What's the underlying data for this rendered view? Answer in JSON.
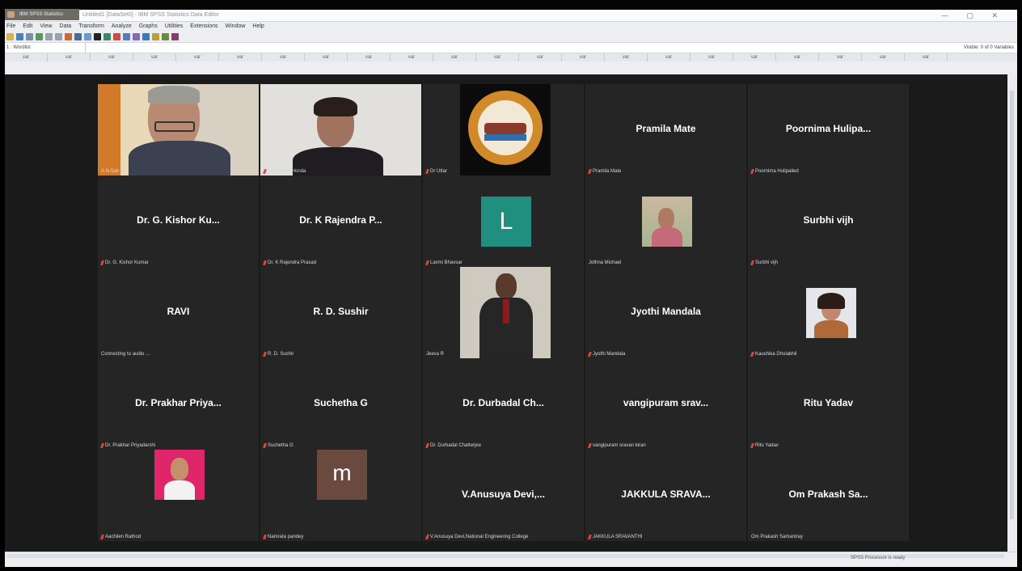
{
  "window": {
    "title": "Untitled1 [DataSet0] - IBM SPSS Statistics Data Editor",
    "logo_label": "IBM SPSS Statistics"
  },
  "menu": [
    "File",
    "Edit",
    "View",
    "Data",
    "Transform",
    "Analyze",
    "Graphs",
    "Utilities",
    "Extensions",
    "Window",
    "Help"
  ],
  "spss": {
    "var_cell": "1 : Wordlist",
    "visible": "Visible: 0 of 0 Variables",
    "status": "SPSS Processor is ready",
    "columns": [
      "var",
      "var",
      "var",
      "var",
      "var",
      "var",
      "var",
      "var",
      "var",
      "var",
      "var",
      "var",
      "var",
      "var",
      "var",
      "var",
      "var",
      "var",
      "var",
      "var",
      "var",
      "var"
    ]
  },
  "participants": [
    {
      "label": "A.N.Sah",
      "muted": false
    },
    {
      "label": "Dr.Sunitha Honda",
      "muted": true
    },
    {
      "label": "Dr Uttar",
      "muted": true
    },
    {
      "name": "Pramila Mate",
      "label": "Pramila Mate",
      "muted": true
    },
    {
      "name": "Poornima Hulipa...",
      "label": "Poornima Hulipalled",
      "muted": true
    },
    {
      "name": "Dr. G. Kishor Ku...",
      "label": "Dr. G. Kishor Kumar",
      "muted": true
    },
    {
      "name": "Dr. K Rajendra P...",
      "label": "Dr. K Rajendra Prasad",
      "muted": true
    },
    {
      "avatar_letter": "L",
      "label": "Laxmi Bhavsar",
      "muted": true
    },
    {
      "label": "Jothna Michael",
      "muted": false
    },
    {
      "name": "Surbhi vijh",
      "label": "Surbhi vijh",
      "muted": true
    },
    {
      "name": "RAVI",
      "label": "Connecting to audio ...",
      "muted": false
    },
    {
      "name": "R. D. Sushir",
      "label": "R. D. Sushir",
      "muted": true
    },
    {
      "label": "Jeeva R",
      "muted": false
    },
    {
      "name": "Jyothi Mandala",
      "label": "Jyothi Mandala",
      "muted": true
    },
    {
      "label": "Kaushika Dhulabhil",
      "muted": true
    },
    {
      "name": "Dr. Prakhar Priya...",
      "label": "Dr. Prakhar Priyadarshi",
      "muted": true
    },
    {
      "name": "Suchetha G",
      "label": "Suchetha G",
      "muted": true
    },
    {
      "name": "Dr. Durbadal Ch...",
      "label": "Dr. Durbadal Chatterjee",
      "muted": true
    },
    {
      "name": "vangipuram srav...",
      "label": "vangipuram sravan kiran",
      "muted": true
    },
    {
      "name": "Ritu Yadav",
      "label": "Ritu Yadav",
      "muted": true
    },
    {
      "label": "Aachilen Rathod",
      "muted": true
    },
    {
      "avatar_letter": "m",
      "label": "Namrata pandey",
      "muted": true
    },
    {
      "name": "V.Anusuya Devi,...",
      "label": "V.Anusuya Devi,National Engineering College",
      "muted": true
    },
    {
      "name": "JAKKULA SRAVA...",
      "label": "JAKKULA SRAVANTHI",
      "muted": true
    },
    {
      "name": "Om Prakash Sa...",
      "label": "Om Prakash Samantray",
      "muted": false
    }
  ],
  "colors": {
    "active_speaker": "#b8d134",
    "tile_bg": "#252525",
    "muted_icon": "#e04646",
    "avatar_L": "#1f8f80",
    "avatar_m": "#6a4a3e"
  }
}
